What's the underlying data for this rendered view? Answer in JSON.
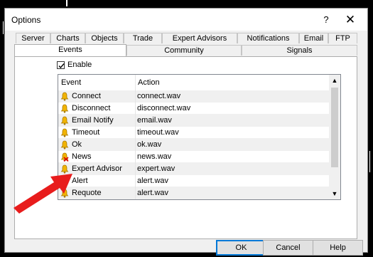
{
  "window": {
    "title": "Options",
    "help_glyph": "?",
    "close_glyph": "✕"
  },
  "tabs_top": [
    "Server",
    "Charts",
    "Objects",
    "Trade",
    "Expert Advisors",
    "Notifications",
    "Email",
    "FTP"
  ],
  "tabs_bottom": [
    "Events",
    "Community",
    "Signals"
  ],
  "active_tab": "Events",
  "enable": {
    "label": "Enable",
    "checked": true
  },
  "table": {
    "columns": [
      "Event",
      "Action"
    ],
    "rows": [
      {
        "event": "Connect",
        "action": "connect.wav",
        "icon": "bell-icon"
      },
      {
        "event": "Disconnect",
        "action": "disconnect.wav",
        "icon": "bell-icon"
      },
      {
        "event": "Email Notify",
        "action": "email.wav",
        "icon": "bell-icon"
      },
      {
        "event": "Timeout",
        "action": "timeout.wav",
        "icon": "bell-icon"
      },
      {
        "event": "Ok",
        "action": "ok.wav",
        "icon": "bell-icon"
      },
      {
        "event": "News",
        "action": "news.wav",
        "icon": "bell-disabled-icon"
      },
      {
        "event": "Expert Advisor",
        "action": "expert.wav",
        "icon": "bell-icon"
      },
      {
        "event": "Alert",
        "action": "alert.wav",
        "icon": "bell-icon"
      },
      {
        "event": "Requote",
        "action": "alert.wav",
        "icon": "bell-icon"
      }
    ]
  },
  "buttons": {
    "ok": "OK",
    "cancel": "Cancel",
    "help": "Help"
  },
  "colors": {
    "accent": "#0078d7",
    "arrow": "#e81c1c",
    "bell": "#f2b400"
  }
}
